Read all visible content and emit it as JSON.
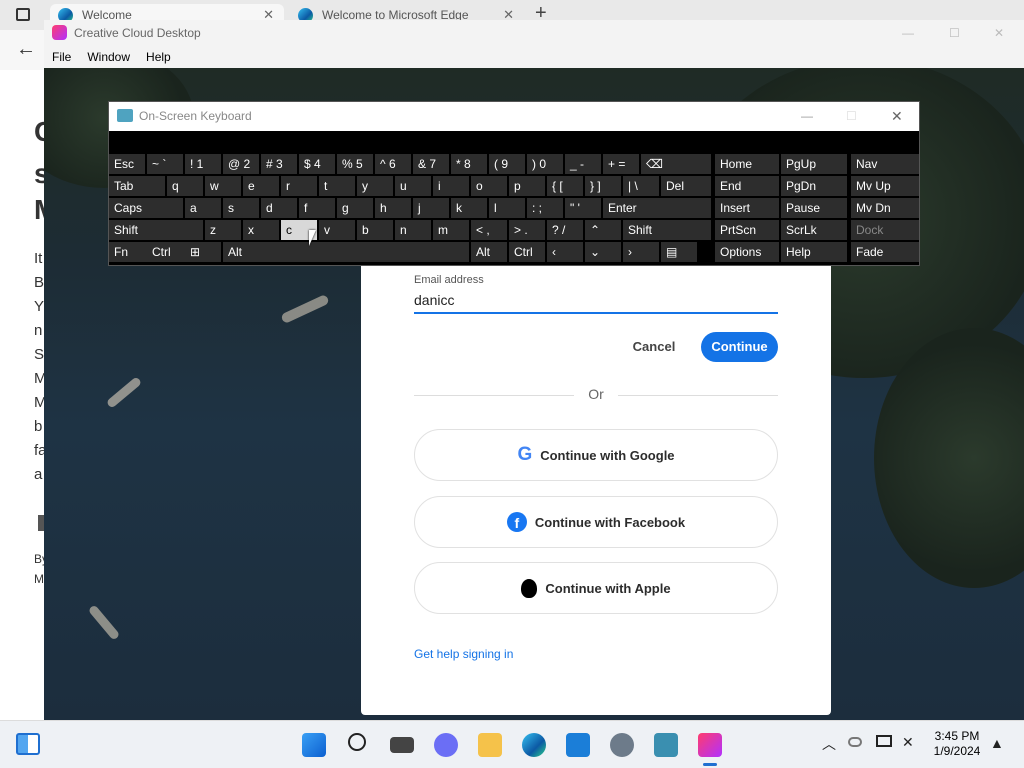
{
  "edge": {
    "tabs": [
      {
        "title": "Welcome"
      },
      {
        "title": "Welcome to Microsoft Edge"
      }
    ],
    "behind_letters": [
      "C",
      "s",
      "M",
      "It",
      "B",
      "Y",
      "n",
      "S",
      "M",
      "M",
      "b",
      "fa",
      "a",
      "By",
      "M"
    ]
  },
  "cc": {
    "window_title": "Creative Cloud Desktop",
    "menu": [
      "File",
      "Window",
      "Help"
    ]
  },
  "signin": {
    "email_label": "Email address",
    "email_value": "danicc",
    "cancel_label": "Cancel",
    "continue_label": "Continue",
    "or_label": "Or",
    "google_label": "Continue with Google",
    "facebook_label": "Continue with Facebook",
    "apple_label": "Continue with Apple",
    "help_link": "Get help signing in",
    "accent_color": "#1473e6"
  },
  "osk": {
    "title": "On-Screen Keyboard",
    "row1": [
      "Esc",
      "~ `",
      "! 1",
      "@ 2",
      "# 3",
      "$ 4",
      "% 5",
      "^ 6",
      "& 7",
      "* 8",
      "( 9",
      ") 0",
      "_ -",
      "+ ="
    ],
    "row2": [
      "Tab",
      "q",
      "w",
      "e",
      "r",
      "t",
      "y",
      "u",
      "i",
      "o",
      "p",
      "{ [",
      "} ]",
      "| \\",
      "Del"
    ],
    "row3": [
      "Caps",
      "a",
      "s",
      "d",
      "f",
      "g",
      "h",
      "j",
      "k",
      "l",
      ": ;",
      "\" '",
      "Enter"
    ],
    "row4": [
      "Shift",
      "z",
      "x",
      "c",
      "v",
      "b",
      "n",
      "m",
      "< ,",
      "> .",
      "? /",
      "Shift"
    ],
    "row5": [
      "Fn",
      "Ctrl",
      "Alt",
      "Alt",
      "Ctrl"
    ],
    "nav1": [
      "Home",
      "End",
      "Insert",
      "PrtScn",
      "Options"
    ],
    "nav2": [
      "PgUp",
      "PgDn",
      "Pause",
      "ScrLk",
      "Help"
    ],
    "nav3": [
      "Nav",
      "Mv Up",
      "Mv Dn",
      "Dock",
      "Fade"
    ]
  },
  "taskbar": {
    "time": "3:45 PM",
    "date": "1/9/2024"
  }
}
